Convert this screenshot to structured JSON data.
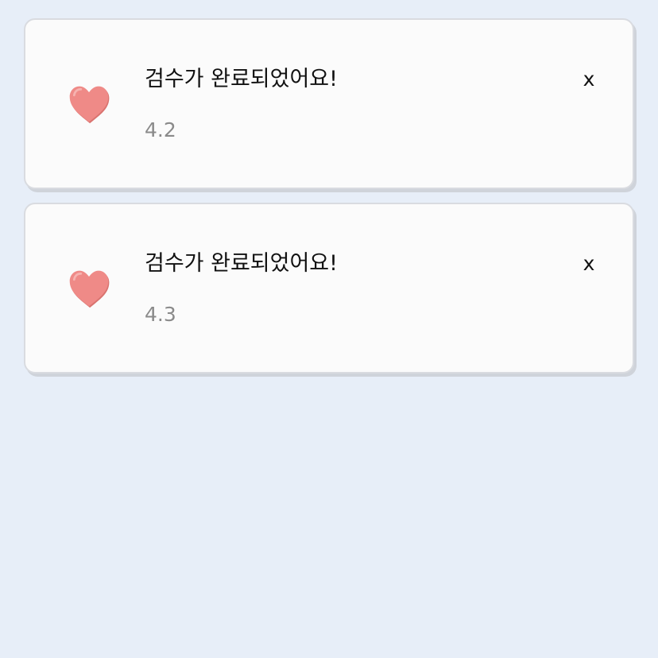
{
  "notifications": [
    {
      "icon": "heart-icon",
      "title": "검수가 완료되었어요!",
      "version": "4.2",
      "close_label": "x"
    },
    {
      "icon": "heart-icon",
      "title": "검수가 완료되었어요!",
      "version": "4.3",
      "close_label": "x"
    }
  ],
  "colors": {
    "background": "#e7eef8",
    "card": "#fbfbfb",
    "heart": "#ee8a87",
    "secondary_text": "#8a8a8a"
  }
}
